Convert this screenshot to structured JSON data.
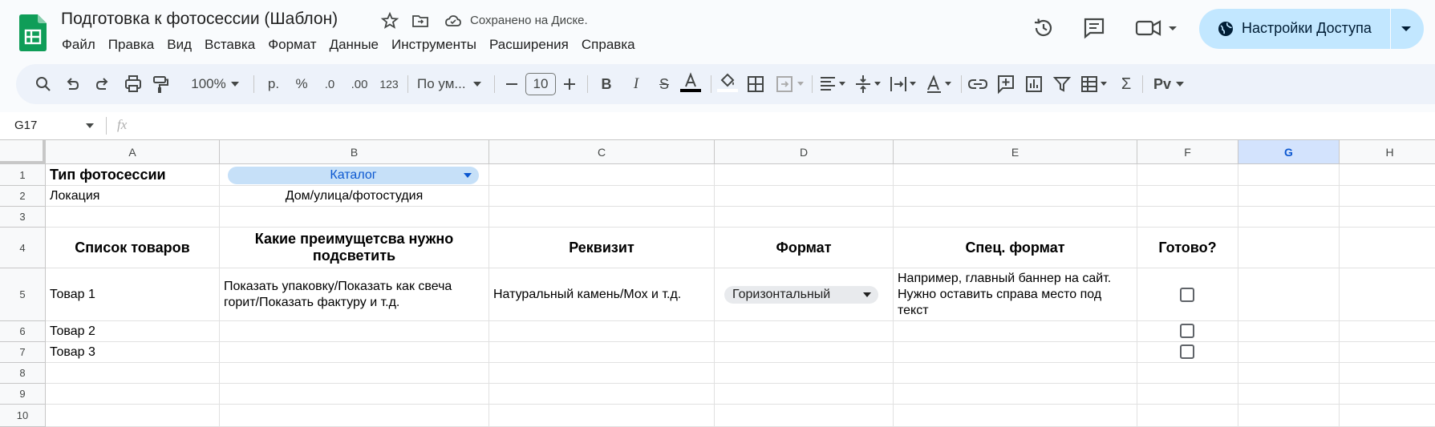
{
  "colors": {
    "accent": "#0b57d0",
    "share_bg": "#c2e7ff",
    "chip_catalog": "#c6e0f8",
    "chip_format": "#e8eaed",
    "sheets_green": "#0f9d58"
  },
  "doc": {
    "title": "Подготовка к фотосессии (Шаблон)",
    "saved": "Сохранено на Диске."
  },
  "menu": [
    "Файл",
    "Правка",
    "Вид",
    "Вставка",
    "Формат",
    "Данные",
    "Инструменты",
    "Расширения",
    "Справка"
  ],
  "share": {
    "label": "Настройки Доступа"
  },
  "toolbar": {
    "zoom": "100%",
    "currency": "р.",
    "percent": "%",
    "dec_less": ".0",
    "dec_more": ".00",
    "number_format": "123",
    "font": "По ум...",
    "font_size": "10"
  },
  "formula": {
    "cell_ref": "G17",
    "fx": "fx",
    "value": ""
  },
  "columns": [
    "A",
    "B",
    "C",
    "D",
    "E",
    "F",
    "G",
    "H"
  ],
  "rows": [
    "1",
    "2",
    "3",
    "4",
    "5",
    "6",
    "7",
    "8",
    "9",
    "10"
  ],
  "cells": {
    "A1": "Тип фотосессии",
    "B1": "Каталог",
    "A2": "Локация",
    "B2": "Дом/улица/фотостудия",
    "A4": "Список товаров",
    "B4": "Какие преимущетсва нужно подсветить",
    "C4": "Реквизит",
    "D4": "Формат",
    "E4": "Спец. формат",
    "F4": "Готово?",
    "A5": "Товар 1",
    "B5": "Показать упаковку/Показать как свеча горит/Показать фактуру и т.д.",
    "C5": "Натуральный камень/Мох и т.д.",
    "D5": "Горизонтальный",
    "E5": "Например, главный баннер на сайт. Нужно оставить справа место под текст",
    "A6": "Товар 2",
    "A7": "Товар 3"
  },
  "checkboxes": {
    "F5": false,
    "F6": false,
    "F7": false
  },
  "icons": [
    "sheets-logo-icon",
    "star-icon",
    "move-icon",
    "cloud-saved-icon",
    "history-icon",
    "comment-icon",
    "video-call-icon",
    "globe-icon",
    "chevron-down-icon",
    "search-icon",
    "undo-icon",
    "redo-icon",
    "print-icon",
    "paint-format-icon",
    "bold-icon",
    "italic-icon",
    "strikethrough-icon",
    "text-color-icon",
    "fill-color-icon",
    "borders-icon",
    "merge-icon",
    "align-icon",
    "valign-icon",
    "wrap-icon",
    "rotate-icon",
    "link-icon",
    "add-comment-icon",
    "chart-icon",
    "filter-icon",
    "table-icon",
    "function-icon",
    "input-tools-icon"
  ]
}
